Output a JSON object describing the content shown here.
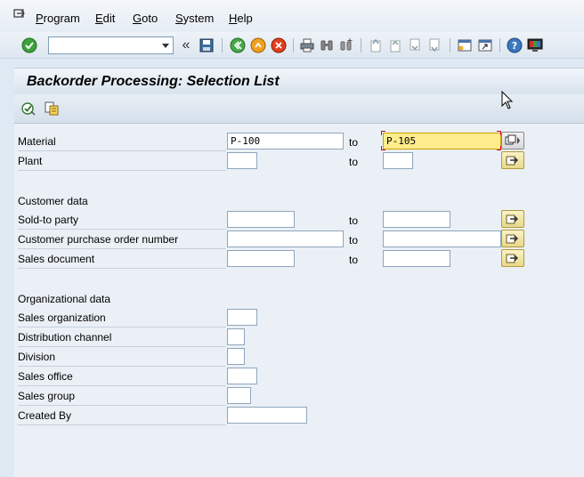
{
  "menu": {
    "items": [
      {
        "key": "P",
        "rest": "rogram"
      },
      {
        "key": "E",
        "rest": "dit"
      },
      {
        "key": "G",
        "rest": "oto"
      },
      {
        "key": "S",
        "rest": "ystem"
      },
      {
        "key": "H",
        "rest": "elp"
      }
    ]
  },
  "toolbar": {
    "command_field_value": "",
    "back_chevron": "«"
  },
  "title": "Backorder Processing: Selection List",
  "labels": {
    "to": "to",
    "customer_data": "Customer data",
    "org_data": "Organizational data"
  },
  "fields": {
    "material": {
      "label": "Material",
      "from": "P-100",
      "to": "P-105"
    },
    "plant": {
      "label": "Plant",
      "from": "",
      "to": ""
    },
    "sold_to": {
      "label": "Sold-to party",
      "from": "",
      "to": ""
    },
    "cust_po": {
      "label": "Customer purchase order number",
      "from": "",
      "to": ""
    },
    "sales_doc": {
      "label": "Sales document",
      "from": "",
      "to": ""
    },
    "sales_org": {
      "label": "Sales organization",
      "value": ""
    },
    "dist_channel": {
      "label": "Distribution channel",
      "value": ""
    },
    "division": {
      "label": "Division",
      "value": ""
    },
    "sales_office": {
      "label": "Sales office",
      "value": ""
    },
    "sales_group": {
      "label": "Sales group",
      "value": ""
    },
    "created_by": {
      "label": "Created By",
      "value": ""
    }
  },
  "colors": {
    "focus_field": "#ffec8c",
    "multi_button": "#e9d98a",
    "title_bg": "#d8e3ee"
  }
}
